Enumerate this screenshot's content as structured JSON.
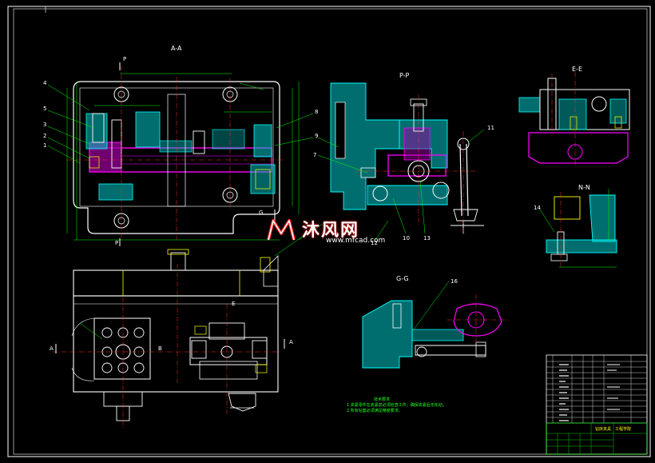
{
  "sections": {
    "aa": "A-A",
    "pp": "P-P",
    "ee": "E-E",
    "nn": "N-N",
    "gg": "G-G"
  },
  "cut_marks": {
    "p_top": "P",
    "p_bottom": "P",
    "g_right": "G",
    "a_left": "A",
    "a_right": "A",
    "b_mid": "B",
    "e_mid": "E"
  },
  "part_numbers": {
    "n4": "4",
    "n5": "5",
    "n3": "3",
    "n2": "2",
    "n1": "1",
    "n8": "8",
    "n9": "9",
    "n7": "7",
    "n11": "11",
    "n10": "10",
    "n13": "13",
    "n12": "12",
    "n16": "16",
    "n14": "14"
  },
  "watermark": {
    "brand": "沐风网",
    "url": "www.mfcad.com"
  },
  "tech_notes": {
    "title": "技术要求",
    "line1": "1.夹紧零件在夹紧前必须检查工件，确保夹紧后无松动。",
    "line2": "2.所有钻套必须满足精度要求。"
  },
  "title_block": {
    "drawing_name": "钻床夹具",
    "company": "工程学院"
  },
  "colors": {
    "outline": "#ffffff",
    "section_fill": "#00c8c8",
    "part_magenta": "#ff00ff",
    "dimension": "#00ff00",
    "centerline": "#ff3030",
    "hidden_yellow": "#ffff00",
    "watermark_glow": "#ff0000"
  }
}
